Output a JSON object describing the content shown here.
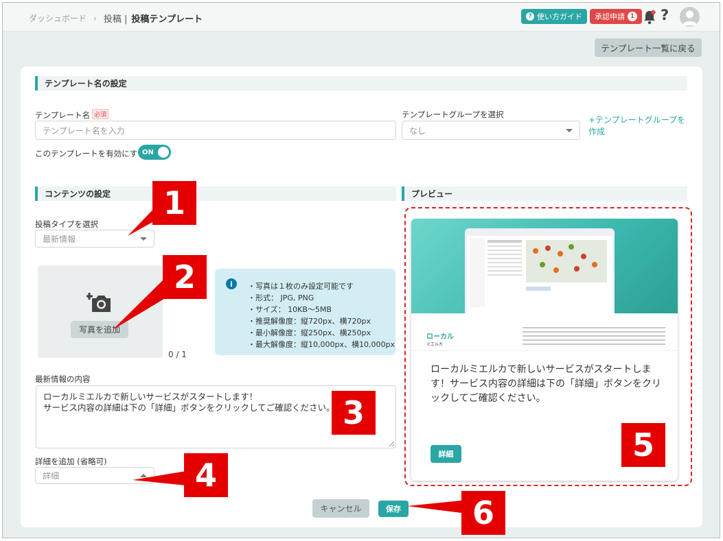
{
  "breadcrumb": {
    "home": "ダッシュボード",
    "separator": "›",
    "section": "投稿 |",
    "current": "投稿テンプレート"
  },
  "header": {
    "guide_label": "使い方ガイド",
    "approval_label": "承認申請",
    "approval_count": "1",
    "help_symbol": "?"
  },
  "back_button": "テンプレート一覧に戻る",
  "template_section": {
    "title": "テンプレート名の設定",
    "name_label": "テンプレート名",
    "required_badge": "必須",
    "name_placeholder": "テンプレート名を入力",
    "group_label": "テンプレートグループを選択",
    "group_value": "なし",
    "create_group_link": "+テンプレートグループを作成",
    "enable_label": "このテンプレートを有効にする",
    "toggle_label": "ON"
  },
  "content_section": {
    "title": "コンテンツの設定",
    "type_label": "投稿タイプを選択",
    "type_value": "最新情報",
    "add_photo_button": "写真を追加",
    "photo_count": "0 / 1",
    "info_lines": [
      "・写真は１枚のみ設定可能です",
      "・形式： JPG, PNG",
      "・サイズ： 10KB～5MB",
      "・推奨解像度：縦720px、横720px",
      "・最小解像度：縦250px、横250px",
      "・最大解像度：縦10,000px、横10,000px"
    ],
    "body_label": "最新情報の内容",
    "body_line1": "ローカルミエルカで新しいサービスがスタートします！",
    "body_line2": "サービス内容の詳細は下の「詳細」ボタンをクリックしてご確認ください。",
    "detail_label": "詳細を追加 (省略可)",
    "detail_value": "詳細"
  },
  "preview": {
    "title": "プレビュー",
    "brand": "ローカル",
    "brand_sub": "ミエルカ",
    "text": "ローカルミエルカで新しいサービスがスタートします！サービス内容の詳細は下の「詳細」ボタンをクリックしてご確認ください。",
    "button": "詳細"
  },
  "actions": {
    "cancel": "キャンセル",
    "save": "保存"
  },
  "callouts": [
    "1",
    "2",
    "3",
    "4",
    "5",
    "6"
  ],
  "colors": {
    "accent": "#2aa6a4",
    "alert": "#e04848",
    "callout": "#e50000"
  }
}
